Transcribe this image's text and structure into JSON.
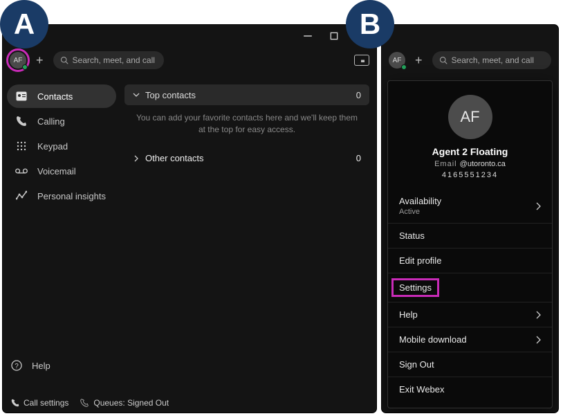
{
  "annotations": {
    "a": "A",
    "b": "B"
  },
  "colors": {
    "highlight": "#c92bb8",
    "badge": "#1a3b66"
  },
  "search": {
    "placeholder": "Search, meet, and call"
  },
  "avatar_initials": "AF",
  "sidebar": {
    "items": [
      {
        "label": "Contacts",
        "icon": "contact-card-icon"
      },
      {
        "label": "Calling",
        "icon": "phone-icon"
      },
      {
        "label": "Keypad",
        "icon": "keypad-icon"
      },
      {
        "label": "Voicemail",
        "icon": "voicemail-icon"
      },
      {
        "label": "Personal insights",
        "icon": "insights-icon"
      }
    ],
    "help_label": "Help"
  },
  "main": {
    "top_section": {
      "label": "Top contacts",
      "count": "0"
    },
    "hint": "You can add your favorite contacts here and we'll keep them at the top for easy access.",
    "other_section": {
      "label": "Other contacts",
      "count": "0"
    }
  },
  "statusbar": {
    "call_settings": "Call settings",
    "queues": "Queues: Signed Out"
  },
  "profile": {
    "initials": "AF",
    "name": "Agent 2 Floating",
    "email_label": "Email",
    "email_domain": "@utoronto.ca",
    "phone": "4165551234"
  },
  "menu": {
    "availability_label": "Availability",
    "availability_value": "Active",
    "status": "Status",
    "edit_profile": "Edit profile",
    "settings": "Settings",
    "help": "Help",
    "mobile_download": "Mobile download",
    "sign_out": "Sign Out",
    "exit": "Exit Webex"
  }
}
